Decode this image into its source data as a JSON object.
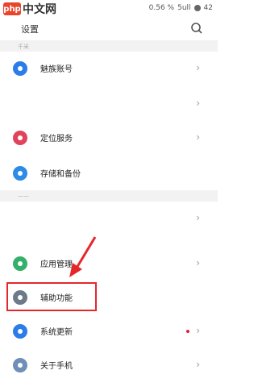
{
  "status_bar": {
    "brand_logo": "php",
    "brand_text": "中文网",
    "speed": "0.56 %",
    "signal": "5ull",
    "battery": "42"
  },
  "header": {
    "title": "设置"
  },
  "sections": [
    {
      "label": "千米"
    },
    {
      "label": "——"
    }
  ],
  "rows": [
    {
      "label": "魅族账号",
      "icon": "account-icon",
      "color": "#2b7de9",
      "chevron": "›"
    },
    {
      "label": "",
      "chevron": "›"
    },
    {
      "label": "定位服务",
      "icon": "location-icon",
      "color": "#e0445a",
      "chevron": "›"
    },
    {
      "label": "存储和备份",
      "icon": "cloud-icon",
      "color": "#2d8ae6",
      "chevron": ""
    },
    {
      "label": "",
      "chevron": "›"
    },
    {
      "label": "应用管理",
      "icon": "apps-icon",
      "color": "#34b06a",
      "chevron": "›"
    },
    {
      "label": "辅助功能",
      "icon": "accessibility-icon",
      "color": "#6c7a8a",
      "chevron": ""
    },
    {
      "label": "系统更新",
      "icon": "update-icon",
      "color": "#2b7de9",
      "chevron": "›",
      "badge": true
    },
    {
      "label": "关于手机",
      "icon": "info-icon",
      "color": "#6f8fb8",
      "chevron": "›"
    }
  ],
  "annotation": {
    "highlight_color": "#e5272b"
  }
}
